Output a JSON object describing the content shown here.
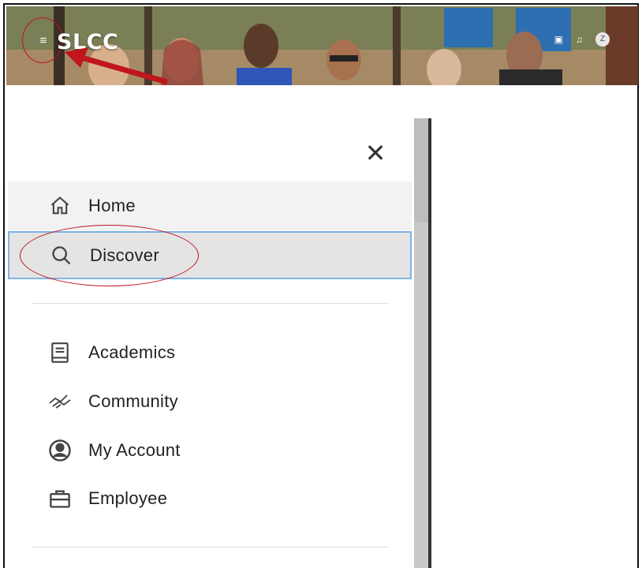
{
  "header": {
    "logo_text": "SLCC",
    "menu_icon": "hamburger-icon",
    "right_icons": [
      "calendar-icon",
      "bell-icon",
      "avatar"
    ],
    "avatar_initial": "Z"
  },
  "menu": {
    "close_icon": "close-icon",
    "items": [
      {
        "label": "Home",
        "icon": "home-icon"
      },
      {
        "label": "Discover",
        "icon": "search-icon",
        "selected": true
      }
    ],
    "sections": [
      {
        "label": "Academics",
        "icon": "book-icon"
      },
      {
        "label": "Community",
        "icon": "handshake-icon"
      },
      {
        "label": "My Account",
        "icon": "account-circle-icon"
      },
      {
        "label": "Employee",
        "icon": "briefcase-icon"
      }
    ]
  },
  "annotation_color": "#c0161d",
  "focus_color": "#7fb2e5"
}
